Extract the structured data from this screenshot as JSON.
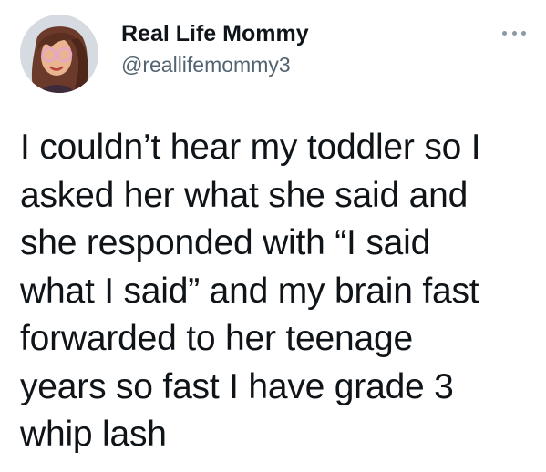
{
  "tweet": {
    "author": {
      "display_name": "Real Life Mommy",
      "handle": "@reallifemommy3"
    },
    "text_lines": [
      "I couldn’t hear my toddler so I",
      "asked her what she said and",
      "she responded with “I said",
      "what I said” and my brain fast",
      "forwarded to her teenage",
      "years so fast I have grade 3",
      "whip lash"
    ],
    "icons": {
      "more": "more-options-icon"
    },
    "colors": {
      "text": "#0f1419",
      "secondary": "#536471",
      "background": "#ffffff"
    }
  }
}
